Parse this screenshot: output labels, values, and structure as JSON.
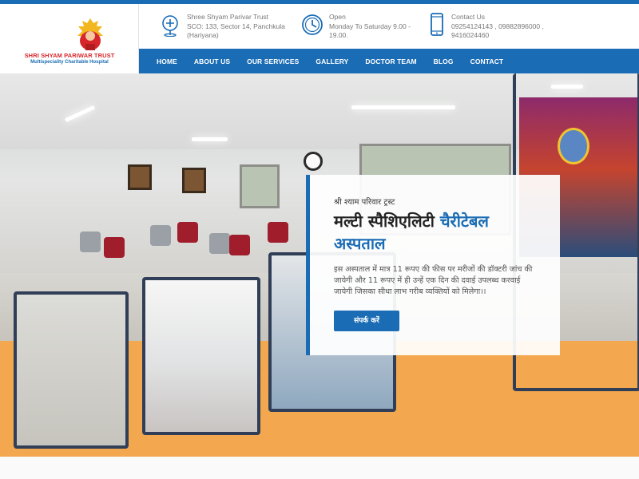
{
  "brand": {
    "name": "SHRI SHYAM PARIWAR TRUST",
    "subtitle": "Multispeciality Charitable Hospital",
    "colors": {
      "primary": "#1a6cb5",
      "brand_red": "#d7262b",
      "accent_orange": "#f3a84f"
    }
  },
  "info_bar": {
    "address": {
      "icon": "location-icon",
      "line1": "Shree Shyam Parivar Trust",
      "line2": "SCO: 133, Sector 14, Panchkula",
      "line3": "(Hariyana)"
    },
    "hours": {
      "icon": "clock-icon",
      "line1": "Open",
      "line2": "Monday To Saturday 9.00 -",
      "line3": "19.00."
    },
    "contact": {
      "icon": "phone-icon",
      "line1": "Contact Us",
      "line2": "09254124143 ,    09882896000 ,",
      "line3": "9416024460"
    }
  },
  "nav": {
    "items": [
      "HOME",
      "ABOUT US",
      "OUR SERVICES",
      "GALLERY",
      "DOCTOR TEAM",
      "BLOG",
      "CONTACT"
    ]
  },
  "hero": {
    "kicker": "श्री श्याम परिवार ट्रस्ट",
    "title_part1": "मल्टी स्पैशिएलिटी ",
    "title_part2": "चैरीटेबल",
    "title_part3": "अस्पताल",
    "body": "इस अस्पताल में मात्र 11 रूपए की फीस पर मरीजों की डॉक्टरी जांच की जायेगी और 11 रूपए में ही उन्हें एक दिन की दवाई उपलब्ध करवाई जायेगी जिसका सीधा लाभ गरीब व्यक्तियों को मिलेगा।।",
    "cta_label": "संपर्क करें"
  }
}
